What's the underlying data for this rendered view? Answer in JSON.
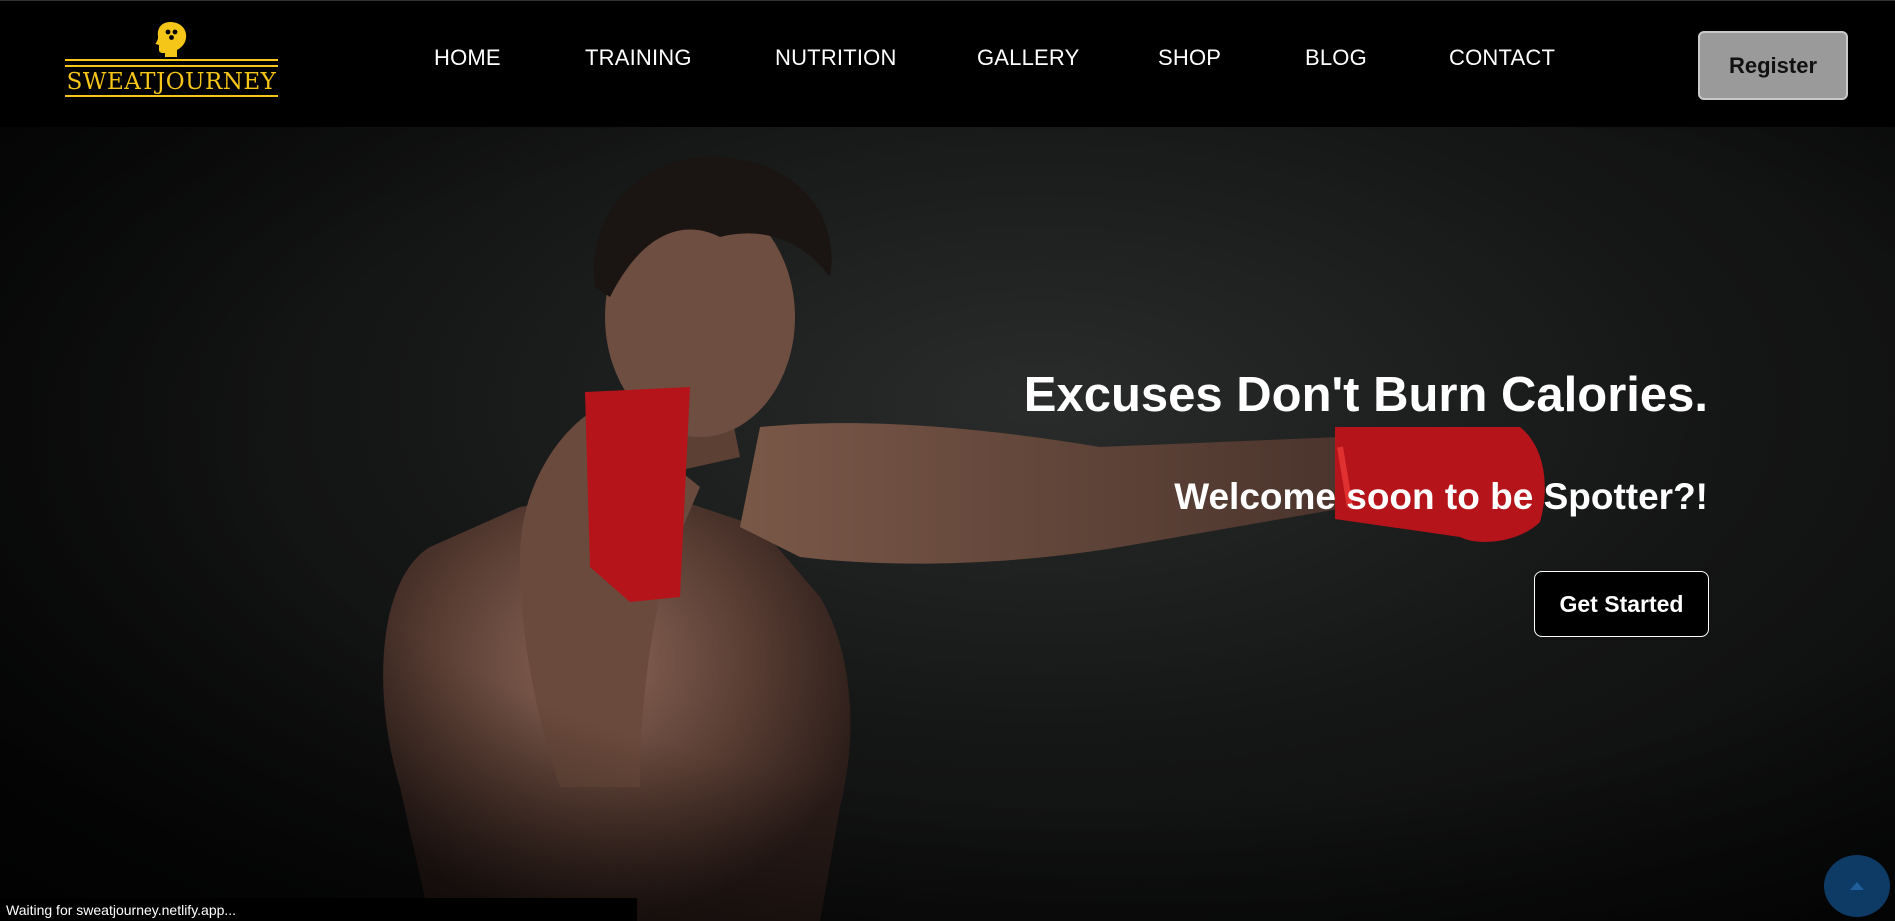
{
  "brand": {
    "name": "SWEATJOURNEY",
    "logo_icon": "head-silhouette-icon",
    "accent_color": "#f5c518"
  },
  "nav": {
    "items": [
      {
        "label": "HOME"
      },
      {
        "label": "TRAINING"
      },
      {
        "label": "NUTRITION"
      },
      {
        "label": "GALLERY"
      },
      {
        "label": "SHOP"
      },
      {
        "label": "BLOG"
      },
      {
        "label": "CONTACT"
      }
    ],
    "register_label": "Register"
  },
  "hero": {
    "headline": "Excuses Don't Burn Calories.",
    "subheadline": "Welcome soon to be Spotter?!",
    "cta_label": "Get Started",
    "image_subject": "boxer with red hand wraps"
  },
  "status_bar": {
    "text": "Waiting for sweatjourney.netlify.app..."
  },
  "scroll_top": {
    "icon": "arrow-up-icon",
    "color": "#0e3a66"
  }
}
